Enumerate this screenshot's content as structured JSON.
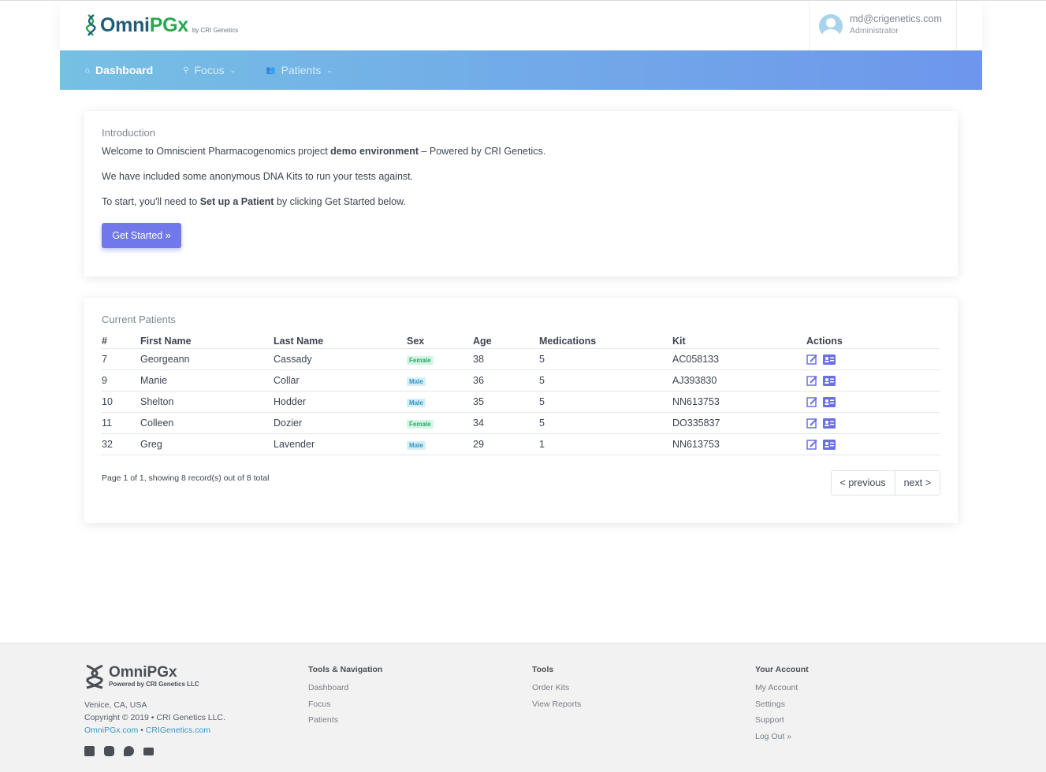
{
  "header": {
    "logo_omni": "Omni",
    "logo_pgx": "PGx",
    "logo_by": "by CRI Genetics",
    "user_email": "md@crigenetics.com",
    "user_role": "Administrator"
  },
  "nav": {
    "items": [
      {
        "label": "Dashboard",
        "icon": "home-icon",
        "active": true
      },
      {
        "label": "Focus",
        "icon": "search-icon",
        "active": false
      },
      {
        "label": "Patients",
        "icon": "users-icon",
        "active": false
      }
    ]
  },
  "intro": {
    "title": "Introduction",
    "line1_a": "Welcome to Omniscient Pharmacogenomics project ",
    "line1_b": "demo environment",
    "line1_c": " – Powered by CRI Genetics.",
    "line2": "We have included some anonymous DNA Kits to run your tests against.",
    "line3_a": "To start, you'll need to ",
    "line3_b": "Set up a Patient",
    "line3_c": " by clicking Get Started below.",
    "button": "Get Started »"
  },
  "patients": {
    "title": "Current Patients",
    "columns": [
      "#",
      "First Name",
      "Last Name",
      "Sex",
      "Age",
      "Medications",
      "Kit",
      "Actions"
    ],
    "rows": [
      {
        "id": "7",
        "first": "Georgeann",
        "last": "Cassady",
        "sex": "Female",
        "age": "38",
        "meds": "5",
        "kit": "AC058133"
      },
      {
        "id": "9",
        "first": "Manie",
        "last": "Collar",
        "sex": "Male",
        "age": "36",
        "meds": "5",
        "kit": "AJ393830"
      },
      {
        "id": "10",
        "first": "Shelton",
        "last": "Hodder",
        "sex": "Male",
        "age": "35",
        "meds": "5",
        "kit": "NN613753"
      },
      {
        "id": "11",
        "first": "Colleen",
        "last": "Dozier",
        "sex": "Female",
        "age": "34",
        "meds": "5",
        "kit": "DO335837"
      },
      {
        "id": "32",
        "first": "Greg",
        "last": "Lavender",
        "sex": "Male",
        "age": "29",
        "meds": "1",
        "kit": "NN613753"
      }
    ],
    "page_info": "Page 1 of 1, showing 8 record(s) out of 8 total",
    "prev": "< previous",
    "next": "next >"
  },
  "footer": {
    "logo_name": "OmniPGx",
    "logo_sub": "Powered by CRI Genetics LLC",
    "location": "Venice, CA, USA",
    "copyright": "Copyright © 2019 • CRI Genetics LLC.",
    "link1": "OmniPGx.com",
    "separator": " • ",
    "link2": "CRIGenetics.com",
    "social": [
      "facebook-icon",
      "instagram-icon",
      "twitter-icon",
      "email-icon"
    ],
    "cols": [
      {
        "title": "Tools & Navigation",
        "items": [
          "Dashboard",
          "Focus",
          "Patients"
        ]
      },
      {
        "title": "Tools",
        "items": [
          "Order Kits",
          "View Reports"
        ]
      },
      {
        "title": "Your Account",
        "items": [
          "My Account",
          "Settings",
          "Support",
          "Log Out »"
        ]
      }
    ]
  },
  "colors": {
    "accent": "#7178ea",
    "nav_start": "#76c0e4",
    "nav_end": "#6e96ec",
    "female_badge": "#2aaa6a",
    "male_badge": "#3196c2",
    "link": "#3c96c8"
  }
}
